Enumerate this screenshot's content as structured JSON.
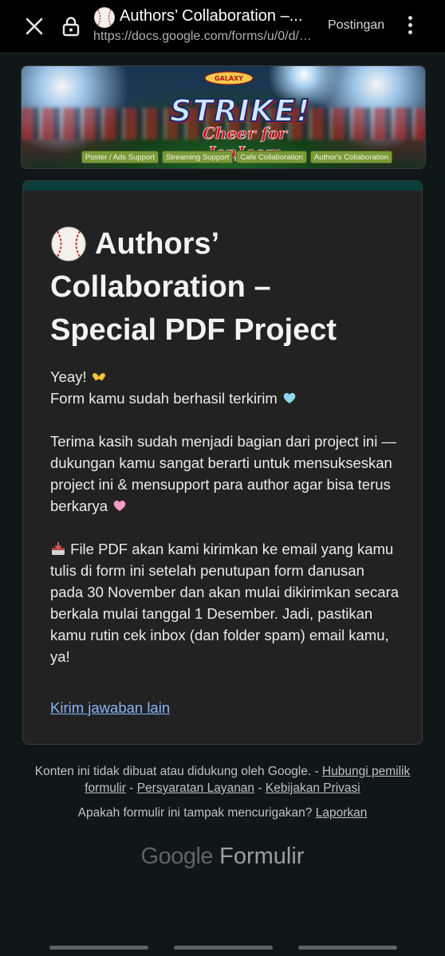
{
  "browser": {
    "tab_title": "Authors’ Collaboration –...",
    "url": "https://docs.google.com/forms/u/0/d/e...",
    "share_label": "Postingan"
  },
  "banner": {
    "logo_small": "GALAXY JenJaem",
    "headline": "STRIKE!",
    "tagline": "Cheer for JenJaem",
    "tabs": [
      {
        "label": "Poster / Ads Support"
      },
      {
        "label": "Streaming Support"
      },
      {
        "label": "Cafe Collaboration"
      },
      {
        "label": "Author's Collaboration"
      }
    ]
  },
  "card": {
    "title_line1": "Authors’",
    "title_line2": "Collaboration –",
    "title_line3": "Special PDF Project",
    "p1_line1": "Yeay!",
    "p1_line2": "Form kamu sudah berhasil terkirim",
    "p2": "Terima kasih sudah menjadi bagian dari project ini — dukungan kamu sangat berarti untuk mensukseskan project ini & mensupport para author agar bisa terus berkarya",
    "p3": "File PDF akan kami kirimkan ke email yang kamu tulis di form ini setelah penutupan form danusan pada 30 November dan akan mulai dikirimkan secara berkala mulai tanggal 1 Desember. Jadi, pastikan kamu rutin cek inbox (dan folder spam) email kamu, ya!",
    "link": "Kirim jawaban lain"
  },
  "footer": {
    "disclaimer": "Konten ini tidak dibuat atau didukung oleh Google. -",
    "contact_owner": "Hubungi pemilik formulir",
    "sep": "-",
    "terms": "Persyaratan Layanan",
    "privacy": "Kebijakan Privasi",
    "suspicious": "Apakah formulir ini tampak mencurigakan?",
    "report": "Laporkan",
    "brand_google": "Google",
    "brand_formulir": "Formulir"
  }
}
